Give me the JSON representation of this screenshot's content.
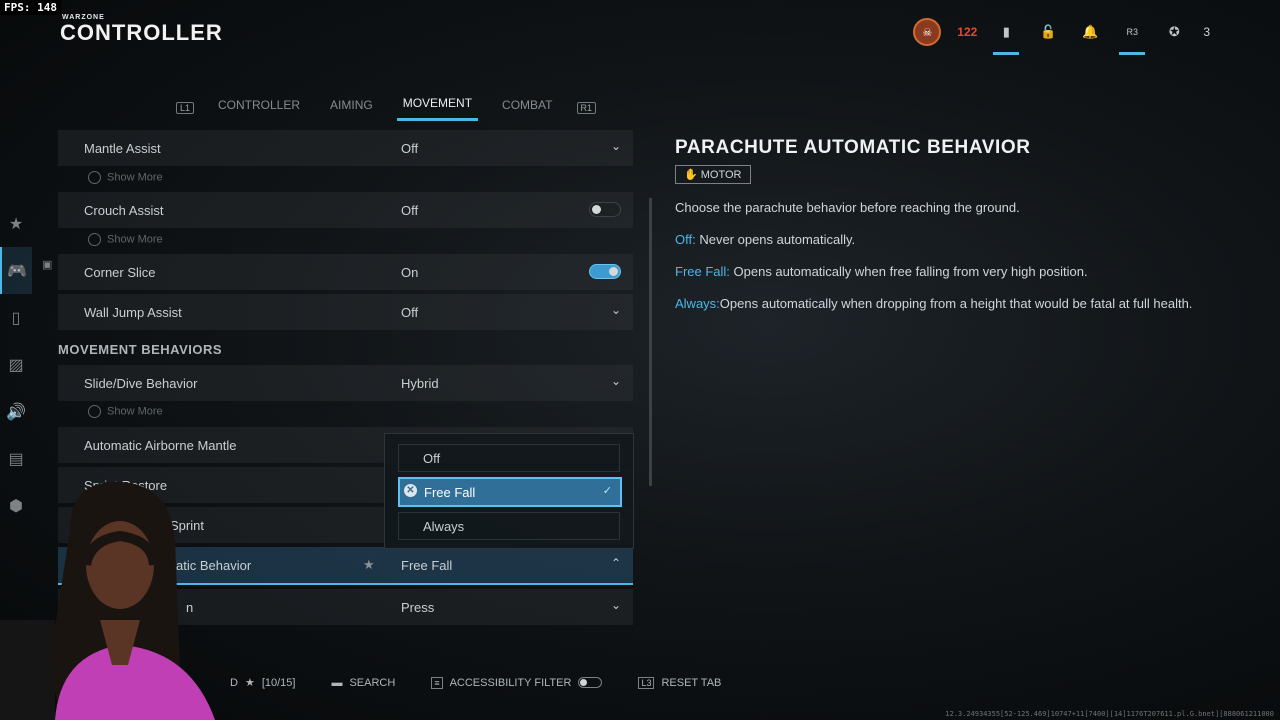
{
  "overlay": {
    "fps": "FPS: 148"
  },
  "header": {
    "brand": "WARZONE",
    "title": "CONTROLLER",
    "level": "122",
    "count": "3",
    "r3": "R3"
  },
  "tabs": {
    "left_key": "L1",
    "right_key": "R1",
    "items": [
      "CONTROLLER",
      "AIMING",
      "MOVEMENT",
      "COMBAT"
    ],
    "active": "MOVEMENT"
  },
  "settings": {
    "show_more": "Show More",
    "section": "MOVEMENT BEHAVIORS",
    "rows": [
      {
        "label": "Mantle Assist",
        "value": "Off"
      },
      {
        "label": "Crouch Assist",
        "value": "Off"
      },
      {
        "label": "Corner Slice",
        "value": "On"
      },
      {
        "label": "Wall Jump Assist",
        "value": "Off"
      },
      {
        "label": "Slide/Dive Behavior",
        "value": "Hybrid"
      },
      {
        "label": "Automatic Airborne Mantle",
        "value": ""
      },
      {
        "label": "Sprint Restore",
        "value": ""
      },
      {
        "label": "Sprint",
        "value": ""
      },
      {
        "label": "atic Behavior",
        "value": "Free Fall"
      },
      {
        "label": "n",
        "value": "Press"
      }
    ]
  },
  "dropdown": {
    "options": [
      "Off",
      "Free Fall",
      "Always"
    ],
    "selected": "Free Fall"
  },
  "detail": {
    "title": "PARACHUTE AUTOMATIC BEHAVIOR",
    "tag": "MOTOR",
    "description": "Choose the parachute behavior before reaching the ground.",
    "items": [
      {
        "key": "Off:",
        "text": " Never opens automatically."
      },
      {
        "key": "Free Fall:",
        "text": " Opens automatically when free falling from very high position."
      },
      {
        "key": "Always:",
        "text": "Opens automatically when dropping from a height that would be fatal at full health."
      }
    ]
  },
  "footer": {
    "favorites": "D",
    "fav_count": "[10/15]",
    "search": "SEARCH",
    "accessibility": "ACCESSIBILITY FILTER",
    "reset": "RESET TAB",
    "reset_key": "L3"
  },
  "version": "12.3.24934355[52-125.469]10747+11[7400][14]1176T207611.pl.G.bnet][888061211000"
}
